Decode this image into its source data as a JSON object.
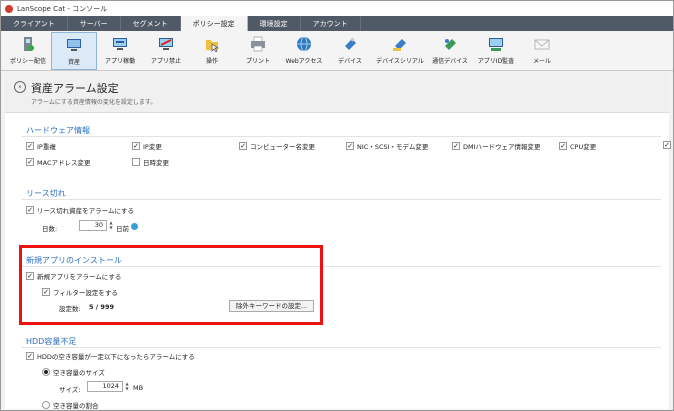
{
  "window": {
    "title": "LanScope Cat - コンソール"
  },
  "tabs": [
    "クライアント",
    "サーバー",
    "セグメント",
    "ポリシー設定",
    "環境設定",
    "アカウント"
  ],
  "active_tab": "ポリシー設定",
  "toolbar": [
    {
      "label": "ポリシー配信",
      "icon": "policy-deploy-icon"
    },
    {
      "label": "資産",
      "icon": "asset-icon"
    },
    {
      "label": "アプリ稼働",
      "icon": "app-running-icon"
    },
    {
      "label": "アプリ禁止",
      "icon": "app-block-icon"
    },
    {
      "label": "操作",
      "icon": "operation-icon"
    },
    {
      "label": "プリント",
      "icon": "print-icon"
    },
    {
      "label": "Webアクセス",
      "icon": "web-access-icon"
    },
    {
      "label": "デバイス",
      "icon": "device-icon"
    },
    {
      "label": "デバイスシリアル",
      "icon": "device-serial-icon"
    },
    {
      "label": "通信デバイス",
      "icon": "network-device-icon"
    },
    {
      "label": "アプリID監査",
      "icon": "app-id-audit-icon"
    },
    {
      "label": "メール",
      "icon": "mail-icon"
    }
  ],
  "active_tool": "資産",
  "page": {
    "title": "資産アラーム設定",
    "subtitle": "アラームにする資産情報の変化を設定します。"
  },
  "hardware": {
    "title": "ハードウェア情報",
    "items": [
      {
        "label": "IP重複",
        "checked": true
      },
      {
        "label": "IP変更",
        "checked": true
      },
      {
        "label": "コンピューター名変更",
        "checked": true
      },
      {
        "label": "NIC・SCSI・モデム変更",
        "checked": true
      },
      {
        "label": "DMIハードウェア情報変更",
        "checked": true
      },
      {
        "label": "CPU変更",
        "checked": true
      },
      {
        "label": "MACアドレス変更",
        "checked": true
      },
      {
        "label": "日時変更",
        "checked": false
      }
    ]
  },
  "lease": {
    "title": "リース切れ",
    "checkbox": "リース切れ資産をアラームにする",
    "days_label": "日数:",
    "days_value": "30",
    "days_suffix": "日前"
  },
  "newapp": {
    "title": "新規アプリのインストール",
    "checkbox": "新規アプリをアラームにする",
    "filter_checkbox": "フィルター設定をする",
    "count_label": "設定数:",
    "count_value": "5 / 999",
    "exclude_button": "除外キーワードの設定..."
  },
  "hdd": {
    "title": "HDD容量不足",
    "checkbox": "HDDの空き容量が一定以下になったらアラームにする",
    "radio_size": "空き容量のサイズ",
    "size_label": "サイズ:",
    "size_value": "1024",
    "size_unit": "MB",
    "radio_ratio": "空き容量の割合"
  }
}
